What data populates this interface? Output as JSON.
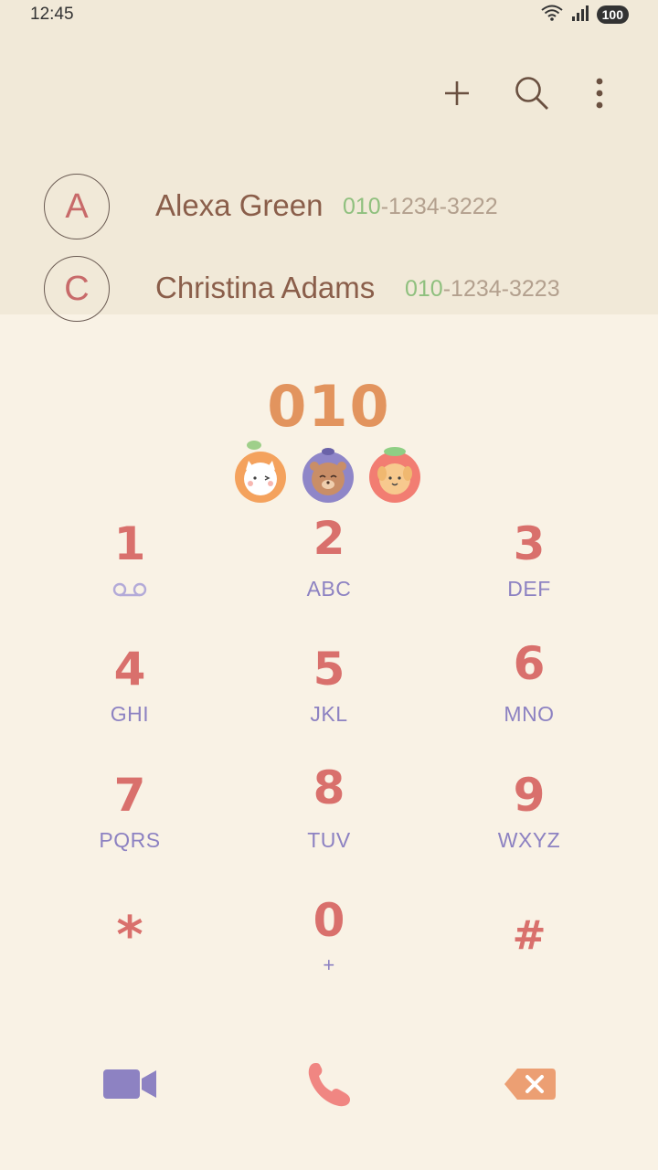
{
  "status_bar": {
    "time": "12:45",
    "battery": "100"
  },
  "toolbar": {
    "icons": [
      "plus-icon",
      "search-icon",
      "more-vertical-icon"
    ]
  },
  "contacts": [
    {
      "initial": "A",
      "name": "Alexa Green",
      "number_prefix": "010",
      "number_rest": "-1234-3222"
    },
    {
      "initial": "C",
      "name": "Christina Adams",
      "number_prefix": "010",
      "number_rest": "-1234-3223"
    }
  ],
  "dialer": {
    "dialed_number": "010",
    "keys": [
      {
        "digit": "1",
        "letters": ""
      },
      {
        "digit": "2",
        "letters": "ABC"
      },
      {
        "digit": "3",
        "letters": "DEF"
      },
      {
        "digit": "4",
        "letters": "GHI"
      },
      {
        "digit": "5",
        "letters": "JKL"
      },
      {
        "digit": "6",
        "letters": "MNO"
      },
      {
        "digit": "7",
        "letters": "PQRS"
      },
      {
        "digit": "8",
        "letters": "TUV"
      },
      {
        "digit": "9",
        "letters": "WXYZ"
      },
      {
        "digit": "*",
        "letters": ""
      },
      {
        "digit": "0",
        "letters": "+"
      },
      {
        "digit": "#",
        "letters": ""
      }
    ]
  },
  "colors": {
    "top_background": "#f1e9d8",
    "dialer_background": "#f9f2e5",
    "digit": "#d9706c",
    "letters": "#8d82c2",
    "dialed_number": "#e2945e",
    "name": "#8a5e4a",
    "number_prefix": "#8fc07e",
    "video_button": "#8d82c2",
    "call_button": "#f08682",
    "backspace_button": "#ec9f73"
  }
}
